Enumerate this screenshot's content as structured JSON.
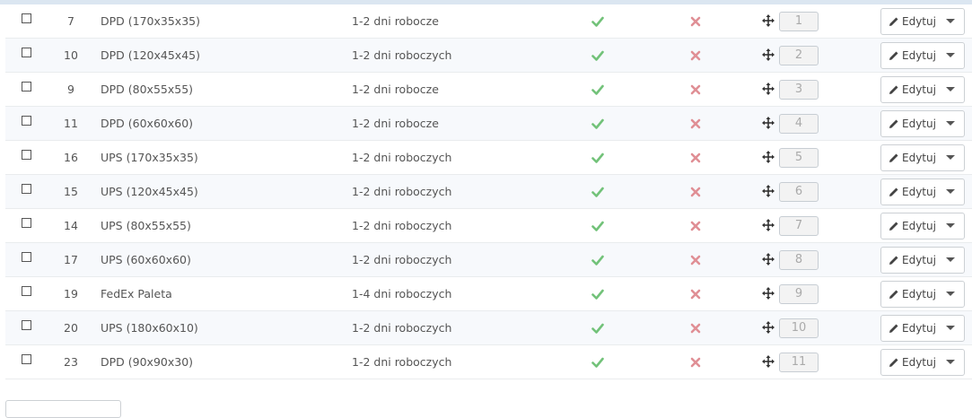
{
  "table": {
    "rows": [
      {
        "id": "7",
        "name": "DPD (170x35x35)",
        "delay": "1-2 dni robocze",
        "active": true,
        "free": false,
        "position": "1"
      },
      {
        "id": "10",
        "name": "DPD (120x45x45)",
        "delay": "1-2 dni roboczych",
        "active": true,
        "free": false,
        "position": "2"
      },
      {
        "id": "9",
        "name": "DPD (80x55x55)",
        "delay": "1-2 dni robocze",
        "active": true,
        "free": false,
        "position": "3"
      },
      {
        "id": "11",
        "name": "DPD (60x60x60)",
        "delay": "1-2 dni robocze",
        "active": true,
        "free": false,
        "position": "4"
      },
      {
        "id": "16",
        "name": "UPS (170x35x35)",
        "delay": "1-2 dni roboczych",
        "active": true,
        "free": false,
        "position": "5"
      },
      {
        "id": "15",
        "name": "UPS (120x45x45)",
        "delay": "1-2 dni roboczych",
        "active": true,
        "free": false,
        "position": "6"
      },
      {
        "id": "14",
        "name": "UPS (80x55x55)",
        "delay": "1-2 dni roboczych",
        "active": true,
        "free": false,
        "position": "7"
      },
      {
        "id": "17",
        "name": "UPS (60x60x60)",
        "delay": "1-2 dni roboczych",
        "active": true,
        "free": false,
        "position": "8"
      },
      {
        "id": "19",
        "name": "FedEx Paleta",
        "delay": "1-4 dni roboczych",
        "active": true,
        "free": false,
        "position": "9"
      },
      {
        "id": "20",
        "name": "UPS (180x60x10)",
        "delay": "1-2 dni roboczych",
        "active": true,
        "free": false,
        "position": "10"
      },
      {
        "id": "23",
        "name": "DPD (90x90x30)",
        "delay": "1-2 dni roboczych",
        "active": true,
        "free": false,
        "position": "11"
      }
    ],
    "edit_label": "Edytuj"
  },
  "colors": {
    "check": "#72c279",
    "cross": "#e08f95",
    "row_alt": "#f7f9fc"
  },
  "icons": {
    "check": "check-icon",
    "cross": "cross-icon",
    "move": "move-icon",
    "pencil": "pencil-icon",
    "caret": "caret-down-icon"
  }
}
